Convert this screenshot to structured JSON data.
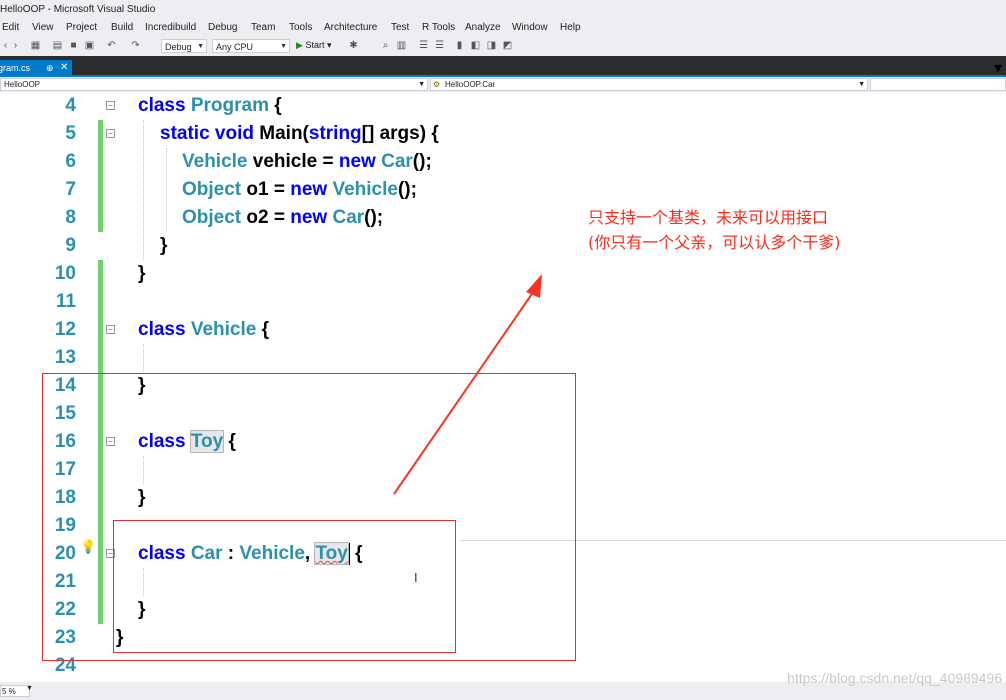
{
  "window": {
    "title": "HelloOOP - Microsoft Visual Studio"
  },
  "menu": [
    "Edit",
    "View",
    "Project",
    "Build",
    "Incredibuild",
    "Debug",
    "Team",
    "Tools",
    "Architecture",
    "Test",
    "R Tools",
    "Analyze",
    "Window",
    "Help"
  ],
  "toolbar": {
    "config": "Debug",
    "platform": "Any CPU",
    "start_label": "Start"
  },
  "tab": {
    "name": "Program.cs",
    "pin": "⊕",
    "close": "✕"
  },
  "nav": {
    "project": "HelloOOP",
    "member": "HelloOOP.Car"
  },
  "line_numbers": [
    "4",
    "5",
    "6",
    "7",
    "8",
    "9",
    "10",
    "11",
    "12",
    "13",
    "14",
    "15",
    "16",
    "17",
    "18",
    "19",
    "20",
    "21",
    "22",
    "23",
    "24"
  ],
  "code": {
    "l4": [
      "class",
      "Program",
      "{"
    ],
    "l5": [
      "static",
      "void",
      "Main(",
      "string",
      "[] args) {"
    ],
    "l6": [
      "Vehicle",
      "vehicle = ",
      "new",
      "Car",
      "();"
    ],
    "l7": [
      "Object",
      "o1 = ",
      "new",
      "Vehicle",
      "();"
    ],
    "l8": [
      "Object",
      "o2 = ",
      "new",
      "Car",
      "();"
    ],
    "l9": "}",
    "l10": "}",
    "l12": [
      "class",
      "Vehicle",
      "{"
    ],
    "l14": "}",
    "l16": [
      "class",
      "Toy",
      "{"
    ],
    "l18": "}",
    "l20": [
      "class",
      "Car",
      " : ",
      "Vehicle",
      ", ",
      "Toy",
      " {"
    ],
    "l22": "}",
    "l23": "}"
  },
  "annotation": {
    "line1": "只支持一个基类，未来可以用接口",
    "line2": "(你只有一个父亲，可以认多个干爹)"
  },
  "status": {
    "zoom": "5 %"
  },
  "watermark": "https://blog.csdn.net/qq_40989496"
}
